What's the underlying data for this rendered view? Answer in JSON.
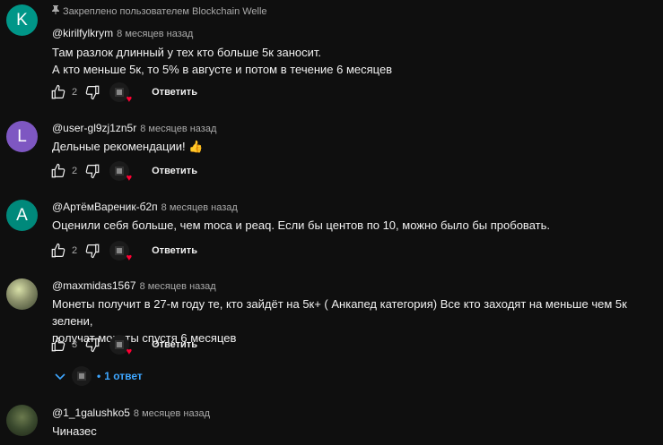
{
  "comments": [
    {
      "pinned": "Закреплено пользователем Blockchain Welle",
      "avatar_letter": "K",
      "avatar_color": "#009688",
      "author": "@kirilfylkrym",
      "time": "8 месяцев назад",
      "lines": [
        "Там разлок длинный у тех кто больше 5к заносит.",
        "А кто меньше 5к, то 5% в августе и потом в течение 6 месяцев"
      ],
      "likes": "2",
      "reply_label": "Ответить"
    },
    {
      "avatar_letter": "L",
      "avatar_color": "#7e57c2",
      "author": "@user-gl9zj1zn5r",
      "time": "8 месяцев назад",
      "lines": [
        "Дельные рекомендации! 👍"
      ],
      "likes": "2",
      "reply_label": "Ответить"
    },
    {
      "avatar_letter": "A",
      "avatar_color": "#00897b",
      "author": "@АртёмВареник-б2п",
      "time": "8 месяцев назад",
      "lines": [
        "Оценили себя больше, чем moca и peaq. Если бы центов по 10, можно было бы пробовать."
      ],
      "likes": "2",
      "reply_label": "Ответить"
    },
    {
      "avatar_letter": "",
      "avatar_color": "#8a8f6a",
      "author": "@maxmidas1567",
      "time": "8 месяцев назад",
      "lines": [
        "Монеты получит в 27-м году те, кто зайдёт на 5к+ ( Анкапед категория) Все кто заходят на меньше чем 5к зелени,",
        "получат монеты спустя 6 месяцев"
      ],
      "likes": "3",
      "reply_label": "Ответить",
      "replies_label": "1 ответ"
    },
    {
      "avatar_letter": "",
      "avatar_color": "#3b4a2e",
      "author": "@1_1galushko5",
      "time": "8 месяцев назад",
      "lines": [
        "Чиназес"
      ]
    }
  ],
  "icons": {
    "like": "thumb-up-icon",
    "dislike": "thumb-down-icon",
    "creator_heart": "creator-heart-icon",
    "pin": "pin-icon",
    "expand": "chevron-down-icon"
  },
  "colors": {
    "background": "#0f0f0f",
    "replies_link": "#3ea6ff",
    "heart": "#ff0033"
  }
}
